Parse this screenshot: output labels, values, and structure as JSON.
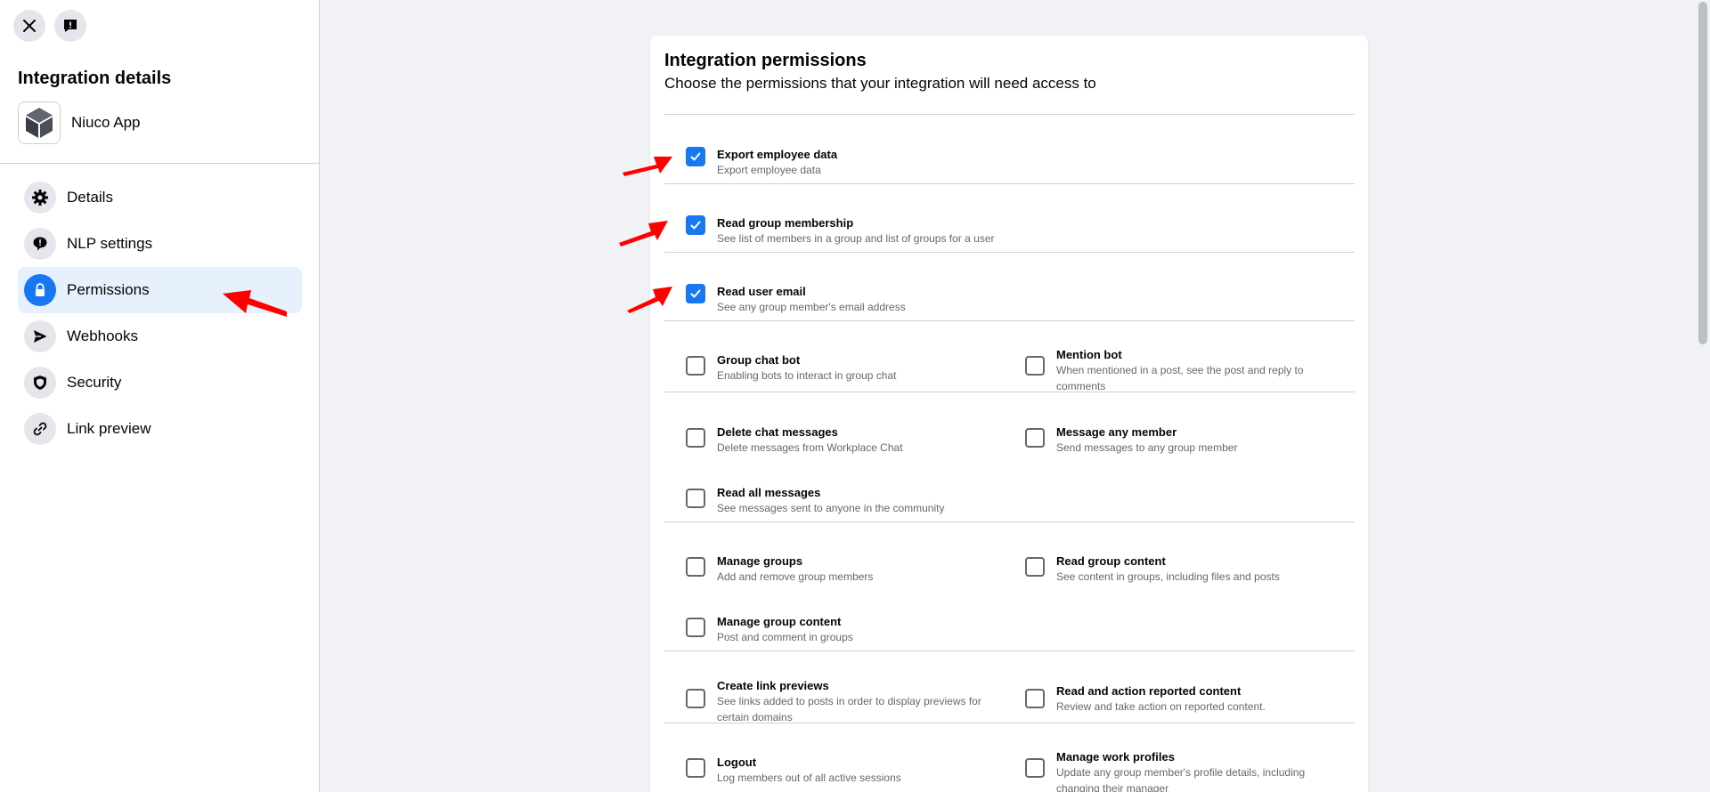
{
  "sidebar": {
    "close_icon": "close-icon",
    "feedback_icon": "feedback-icon",
    "title": "Integration details",
    "app_name": "Niuco App",
    "items": [
      {
        "label": "Details",
        "icon": "gear-icon"
      },
      {
        "label": "NLP settings",
        "icon": "comment-alert-icon"
      },
      {
        "label": "Permissions",
        "icon": "lock-icon",
        "active": true
      },
      {
        "label": "Webhooks",
        "icon": "send-icon"
      },
      {
        "label": "Security",
        "icon": "shield-icon"
      },
      {
        "label": "Link preview",
        "icon": "link-icon"
      }
    ]
  },
  "main": {
    "title": "Integration permissions",
    "subtitle": "Choose the permissions that your integration will need access to",
    "permissions": [
      {
        "title": "Export employee data",
        "desc": "Export employee data",
        "checked": true
      },
      {
        "title": "Read group membership",
        "desc": "See list of members in a group and list of groups for a user",
        "checked": true
      },
      {
        "title": "Read user email",
        "desc": "See any group member's email address",
        "checked": true
      },
      {
        "title": "Group chat bot",
        "desc": "Enabling bots to interact in group chat",
        "checked": false
      },
      {
        "title": "Mention bot",
        "desc": "When mentioned in a post, see the post and reply to comments",
        "checked": false
      },
      {
        "title": "Delete chat messages",
        "desc": "Delete messages from Workplace Chat",
        "checked": false
      },
      {
        "title": "Message any member",
        "desc": "Send messages to any group member",
        "checked": false
      },
      {
        "title": "Read all messages",
        "desc": "See messages sent to anyone in the community",
        "checked": false
      },
      {
        "title": "Manage groups",
        "desc": "Add and remove group members",
        "checked": false
      },
      {
        "title": "Read group content",
        "desc": "See content in groups, including files and posts",
        "checked": false
      },
      {
        "title": "Manage group content",
        "desc": "Post and comment in groups",
        "checked": false
      },
      {
        "title": "Create link previews",
        "desc": "See links added to posts in order to display previews for certain domains",
        "checked": false
      },
      {
        "title": "Read and action reported content",
        "desc": "Review and take action on reported content.",
        "checked": false
      },
      {
        "title": "Logout",
        "desc": "Log members out of all active sessions",
        "checked": false
      },
      {
        "title": "Manage work profiles",
        "desc": "Update any group member's profile details, including changing their manager",
        "checked": false
      }
    ]
  },
  "colors": {
    "accent": "#1877f2",
    "annotation": "#ff0000"
  }
}
